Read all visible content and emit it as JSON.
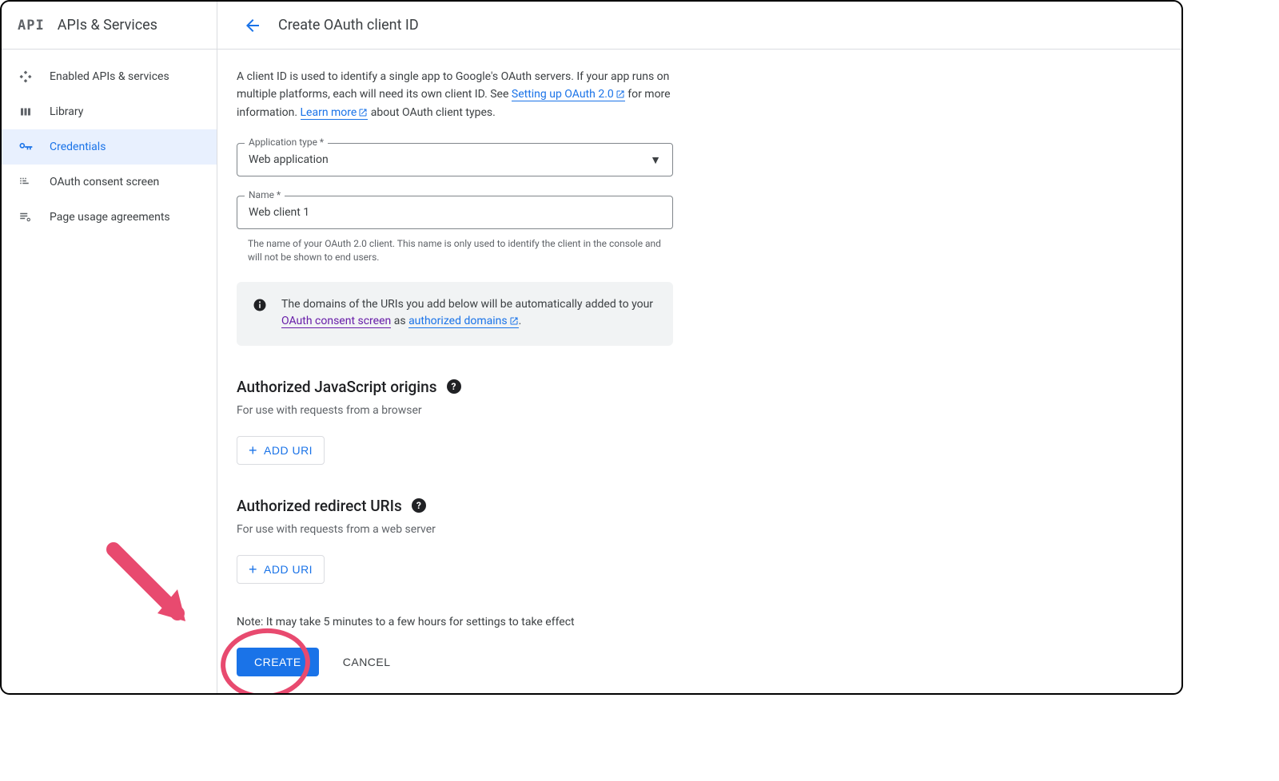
{
  "sidebar": {
    "logo": "API",
    "title": "APIs & Services",
    "items": [
      {
        "label": "Enabled APIs & services"
      },
      {
        "label": "Library"
      },
      {
        "label": "Credentials"
      },
      {
        "label": "OAuth consent screen"
      },
      {
        "label": "Page usage agreements"
      }
    ]
  },
  "header": {
    "title": "Create OAuth client ID"
  },
  "intro": {
    "part1": "A client ID is used to identify a single app to Google's OAuth servers. If your app runs on multiple platforms, each will need its own client ID. See ",
    "link1": "Setting up OAuth 2.0",
    "part2": " for more information. ",
    "link2": "Learn more",
    "part3": " about OAuth client types."
  },
  "form": {
    "app_type_label": "Application type *",
    "app_type_value": "Web application",
    "name_label": "Name *",
    "name_value": "Web client 1",
    "name_help": "The name of your OAuth 2.0 client. This name is only used to identify the client in the console and will not be shown to end users."
  },
  "info": {
    "part1": "The domains of the URIs you add below will be automatically added to your ",
    "link1": "OAuth consent screen",
    "part2": " as ",
    "link2": "authorized domains",
    "part3": "."
  },
  "sections": {
    "js_origins": {
      "title": "Authorized JavaScript origins",
      "sub": "For use with requests from a browser",
      "add": "ADD URI"
    },
    "redirect": {
      "title": "Authorized redirect URIs",
      "sub": "For use with requests from a web server",
      "add": "ADD URI"
    }
  },
  "note": "Note: It may take 5 minutes to a few hours for settings to take effect",
  "actions": {
    "create": "CREATE",
    "cancel": "CANCEL"
  }
}
